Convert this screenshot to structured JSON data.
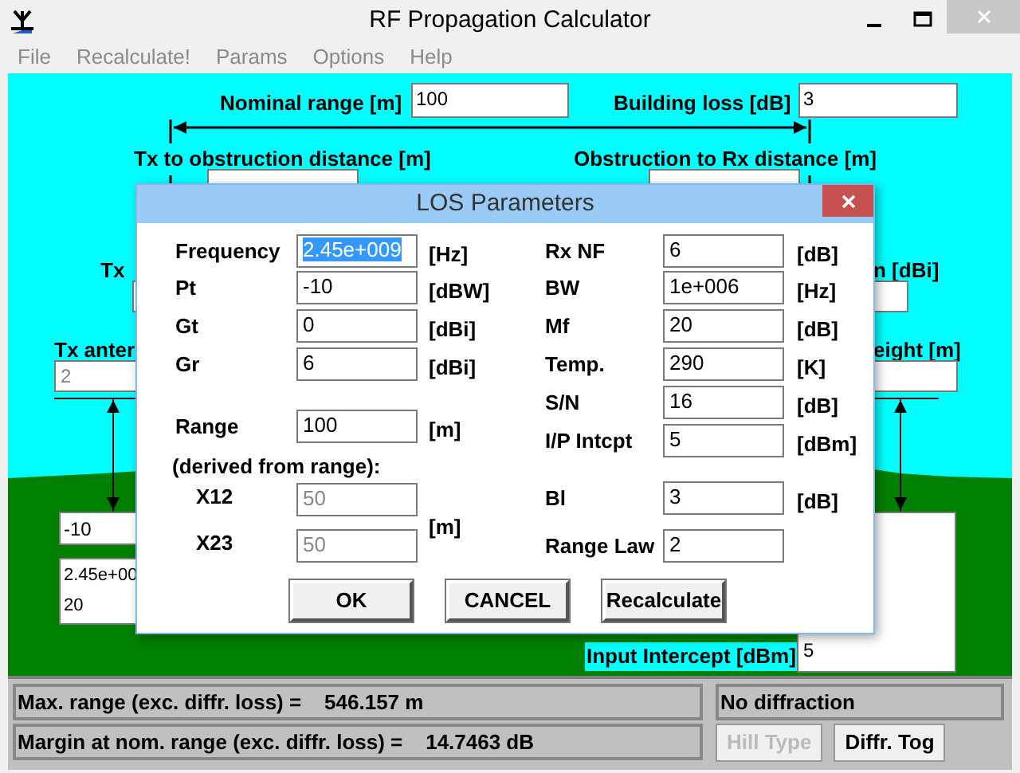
{
  "window": {
    "title": "RF Propagation Calculator"
  },
  "menu": [
    "File",
    "Recalculate!",
    "Params",
    "Options",
    "Help"
  ],
  "canvas": {
    "nominal_range": {
      "label": "Nominal range [m]",
      "value": "100"
    },
    "building_loss": {
      "label": "Building loss [dB]",
      "value": "3"
    },
    "tx_obstruction_label": "Tx to obstruction distance [m]",
    "obstruction_rx_label": "Obstruction to Rx distance [m]",
    "tx_gain_label": "Tx",
    "rx_gain_label": "n [dBi]",
    "tx_height": {
      "label": "Tx anter",
      "value": "2"
    },
    "rx_height_label": "eight [m]",
    "tx_power_value": "-10",
    "tx_info_lines": [
      "2.45e+00",
      "20"
    ],
    "input_intercept": {
      "label": "Input Intercept [dBm]",
      "value": "5"
    }
  },
  "status": {
    "max_range": "Max. range (exc. diffr. loss) =    546.157 m",
    "margin": "Margin at nom. range (exc. diffr. loss) =    14.7463 dB",
    "diffraction": "No diffraction",
    "buttons": [
      {
        "label": "Hill Type",
        "disabled": true
      },
      {
        "label": "Diffr. Tog",
        "disabled": false
      }
    ]
  },
  "dialog": {
    "title": "LOS Parameters",
    "left_fields": [
      {
        "label": "Frequency",
        "value": "2.45e+009",
        "unit": "[Hz]",
        "highlighted": true
      },
      {
        "label": "Pt",
        "value": "-10",
        "unit": "[dBW]",
        "highlighted": false
      },
      {
        "label": "Gt",
        "value": "0",
        "unit": "[dBi]",
        "highlighted": false
      },
      {
        "label": "Gr",
        "value": "6",
        "unit": "[dBi]",
        "highlighted": false
      },
      {
        "label": "Range",
        "value": "100",
        "unit": "[m]",
        "highlighted": false
      }
    ],
    "derived": {
      "note": "(derived from range):",
      "unit": "[m]",
      "fields": [
        {
          "label": "X12",
          "value": "50",
          "disabled": true
        },
        {
          "label": "X23",
          "value": "50",
          "disabled": true
        }
      ]
    },
    "right_fields": [
      {
        "label": "Rx NF",
        "value": "6",
        "unit": "[dB]"
      },
      {
        "label": "BW",
        "value": "1e+006",
        "unit": "[Hz]"
      },
      {
        "label": "Mf",
        "value": "20",
        "unit": "[dB]"
      },
      {
        "label": "Temp.",
        "value": "290",
        "unit": "[K]"
      },
      {
        "label": "S/N",
        "value": "16",
        "unit": "[dB]"
      },
      {
        "label": "I/P Intcpt",
        "value": "5",
        "unit": "[dBm]"
      },
      {
        "label": "Bl",
        "value": "3",
        "unit": "[dB]"
      },
      {
        "label": "Range Law",
        "value": "2"
      }
    ],
    "buttons": [
      "OK",
      "CANCEL",
      "Recalculate"
    ]
  }
}
